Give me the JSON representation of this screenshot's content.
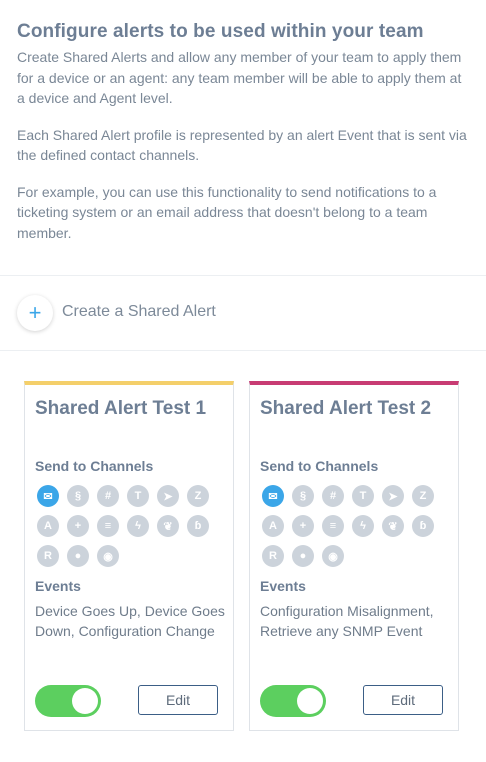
{
  "intro": {
    "title": "Configure alerts to be used within your team",
    "paragraphs": [
      "Create Shared Alerts and allow any member of your team to apply them for a device or an agent: any team member will be able to apply them at a device and Agent level.",
      "Each Shared Alert profile is represented by an alert Event that is sent via the defined contact channels.",
      "For example, you can use this functionality to send notifications to a ticketing system or an email address that doesn't belong to a team member."
    ]
  },
  "create": {
    "icon": "plus-icon",
    "label": "Create a Shared Alert"
  },
  "channel_icons": [
    "email-icon",
    "slack-icon",
    "hash-icon",
    "teams-icon",
    "telegram-icon",
    "zendesk-icon",
    "alert-icon",
    "plus-circle-icon",
    "stack-icon",
    "bolt-icon",
    "leaf-icon",
    "webhook-icon",
    "r-icon",
    "circle-icon",
    "eye-icon"
  ],
  "cards": [
    {
      "title": "Shared Alert Test 1",
      "channels_label": "Send to Channels",
      "events_label": "Events",
      "events": "Device Goes Up, Device Goes Down, Configuration Change",
      "enabled": true,
      "edit_label": "Edit",
      "accent": "#f4cf6a",
      "active_channel": "email-icon"
    },
    {
      "title": "Shared Alert Test 2",
      "channels_label": "Send to Channels",
      "events_label": "Events",
      "events": "Configuration Misalignment, Retrieve any SNMP Event",
      "enabled": true,
      "edit_label": "Edit",
      "accent": "#c83c73",
      "active_channel": "email-icon"
    }
  ],
  "colors": {
    "accent_blue": "#3ba6e8",
    "toggle_on": "#5ccf5f",
    "icon_inactive": "#ccd3db"
  }
}
